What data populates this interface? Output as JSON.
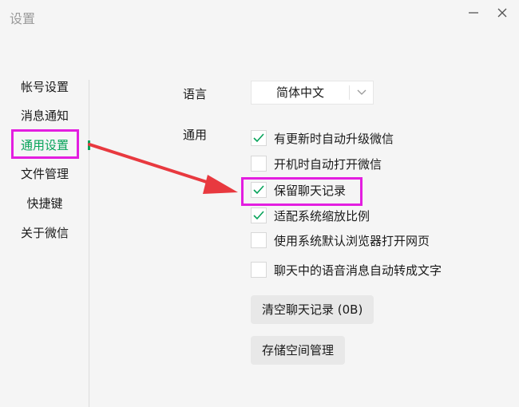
{
  "window": {
    "title": "设置"
  },
  "sidebar": {
    "items": [
      {
        "label": "帐号设置"
      },
      {
        "label": "消息通知"
      },
      {
        "label": "通用设置"
      },
      {
        "label": "文件管理"
      },
      {
        "label": "快捷键"
      },
      {
        "label": "关于微信"
      }
    ],
    "active_index": 2
  },
  "language": {
    "label": "语言",
    "selected": "简体中文"
  },
  "general": {
    "label": "通用",
    "options": [
      {
        "label": "有更新时自动升级微信",
        "checked": true
      },
      {
        "label": "开机时自动打开微信",
        "checked": false
      },
      {
        "label": "保留聊天记录",
        "checked": true
      },
      {
        "label": "适配系统缩放比例",
        "checked": true
      },
      {
        "label": "使用系统默认浏览器打开网页",
        "checked": false
      },
      {
        "label": "聊天中的语音消息自动转成文字",
        "checked": false
      }
    ]
  },
  "buttons": {
    "clear_history": "清空聊天记录 (0B)",
    "storage_manage": "存储空间管理"
  },
  "colors": {
    "accent": "#07a35a",
    "highlight": "#e31ee0",
    "arrow": "#e8393f"
  },
  "icons": {
    "minimize": "minimize-icon",
    "close": "close-icon",
    "dropdown": "chevron-down-icon",
    "check": "check-icon"
  }
}
